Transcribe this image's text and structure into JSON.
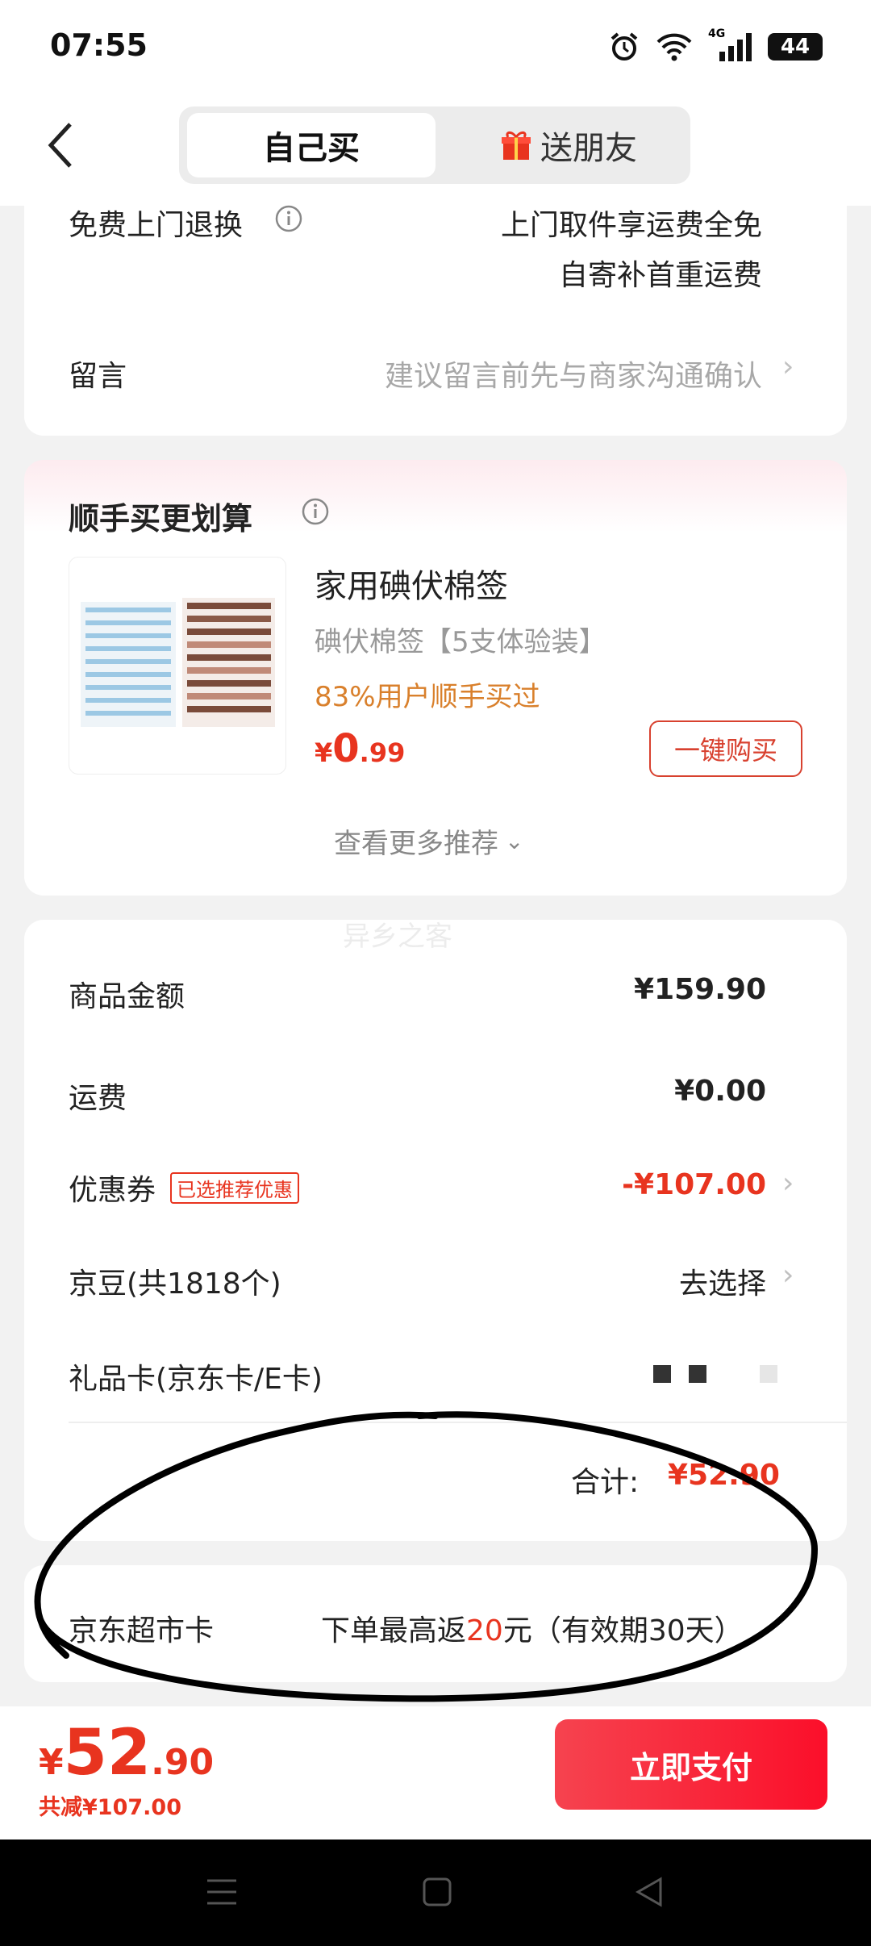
{
  "status": {
    "time": "07:55",
    "network": "4G",
    "battery": "44"
  },
  "header": {
    "self_buy": "自己买",
    "gift": "送朋友"
  },
  "delivery": {
    "return_label": "免费上门退换",
    "return_desc_1": "上门取件享运费全免",
    "return_desc_2": "自寄补首重运费",
    "message_label": "留言",
    "message_placeholder": "建议留言前先与商家沟通确认"
  },
  "recommend": {
    "title": "顺手买更划算",
    "product_name": "家用碘伏棉签",
    "product_spec": "碘伏棉签【5支体验装】",
    "bought_ratio": "83%用户顺手买过",
    "price_symbol": "¥",
    "price_int": "0",
    "price_dec": ".99",
    "buy_button": "一键购买",
    "more": "查看更多推荐"
  },
  "watermark": "异乡之客",
  "summary": {
    "goods_label": "商品金额",
    "goods_value": "¥159.90",
    "shipping_label": "运费",
    "shipping_value": "¥0.00",
    "coupon_label": "优惠券",
    "coupon_tag": "已选推荐优惠",
    "coupon_value": "-¥107.00",
    "beans_label": "京豆(共1818个)",
    "beans_value": "去选择",
    "giftcard_label": "礼品卡(京东卡/E卡)",
    "total_label": "合计:",
    "total_value": "¥52.90"
  },
  "market_card": {
    "label": "京东超市卡",
    "desc_prefix": "下单最高返",
    "desc_amount": "20",
    "desc_suffix": "元（有效期30天）"
  },
  "bottom": {
    "price_symbol": "¥",
    "price_int": "52",
    "price_dec": ".90",
    "discount": "共减¥107.00",
    "pay_button": "立即支付"
  },
  "colors": {
    "accent_red": "#e8341f",
    "pay_gradient_start": "#f6434f",
    "pay_gradient_end": "#fb0f2a",
    "orange": "#d9802c"
  }
}
